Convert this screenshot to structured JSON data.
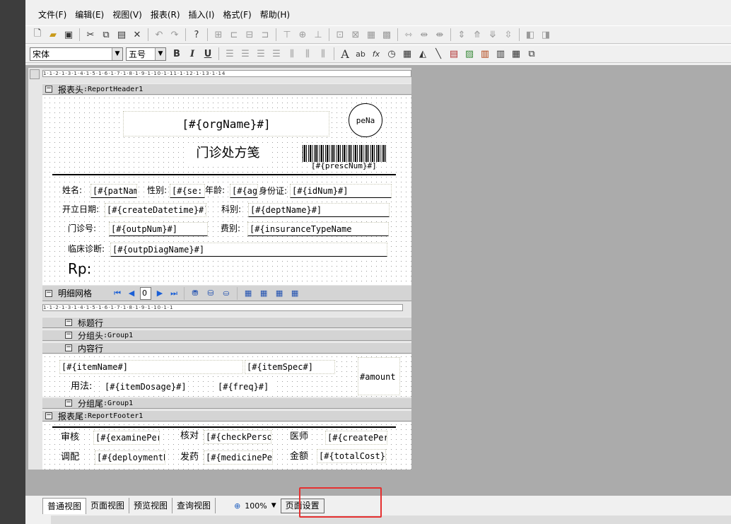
{
  "menu": [
    "文件(F)",
    "编辑(E)",
    "视图(V)",
    "报表(R)",
    "插入(I)",
    "格式(F)",
    "帮助(H)"
  ],
  "font": {
    "family": "宋体",
    "size": "五号"
  },
  "format_buttons": {
    "bold": "B",
    "italic": "I",
    "underline": "U"
  },
  "ruler_top": "1·1·2·1·3·1·4·1·5·1·6·1·7·1·8·1·9·1·10·1·11·1·12·1·13·1·14",
  "ruler_detail": "1·1·2·1·3·1·4·1·5·1·6·1·7·1·8·1·9·1·10·1·1",
  "bands": {
    "report_header": {
      "label": "报表头",
      "name": ":ReportHeader1"
    },
    "detail_grid": {
      "label": "明细网格"
    },
    "title_row": {
      "label": "标题行"
    },
    "group_header": {
      "label": "分组头",
      "name": ":Group1"
    },
    "content_row": {
      "label": "内容行"
    },
    "group_footer": {
      "label": "分组尾",
      "name": ":Group1"
    },
    "report_footer": {
      "label": "报表尾",
      "name": ":ReportFooter1"
    }
  },
  "header_fields": {
    "org_name": "[#{orgName}#]",
    "image_box": "peNa",
    "title": "门诊处方笺",
    "presc_num": "[#{prescNum}#]",
    "name_label": "姓名:",
    "name_field": "[#{patName",
    "sex_label": "性别:",
    "sex_field": "[#{se:",
    "age_label": "年龄:",
    "age_field": "[#{ag",
    "id_label": "身份证:",
    "id_field": "[#{idNum}#]",
    "create_label": "开立日期:",
    "create_field": "[#{createDatetime}#]",
    "dept_label": "科别:",
    "dept_field": "[#{deptName}#]",
    "outp_label": "门诊号:",
    "outp_field": "[#{outpNum}#]",
    "fee_label": "费别:",
    "fee_field": "[#{insuranceTypeName",
    "diag_label": "临床诊断:",
    "diag_field": "[#{outpDiagName}#]",
    "rp": "Rp:"
  },
  "page_number": "0",
  "content_fields": {
    "item_name": "[#{itemName#]",
    "item_spec": "[#{itemSpec#]",
    "amount": "#amount",
    "usage_label": "用法:",
    "dosage": "[#{itemDosage}#]",
    "freq": "[#{freq}#]"
  },
  "footer_fields": {
    "review_label": "审核",
    "review_field": "[#{examinePers",
    "check_label": "核对",
    "check_field": "[#{checkPerson",
    "doctor_label": "医师",
    "doctor_field": "[#{createPer",
    "deploy_label": "调配",
    "deploy_field": "[#{deploymentP",
    "dispense_label": "发药",
    "dispense_field": "[#{medicinePer",
    "amount_label": "金额",
    "amount_field": "[#{totalCost}#"
  },
  "status": {
    "tabs": [
      "普通视图",
      "页面视图",
      "预览视图",
      "查询视图"
    ],
    "zoom": "100%",
    "page_setup": "页面设置"
  }
}
